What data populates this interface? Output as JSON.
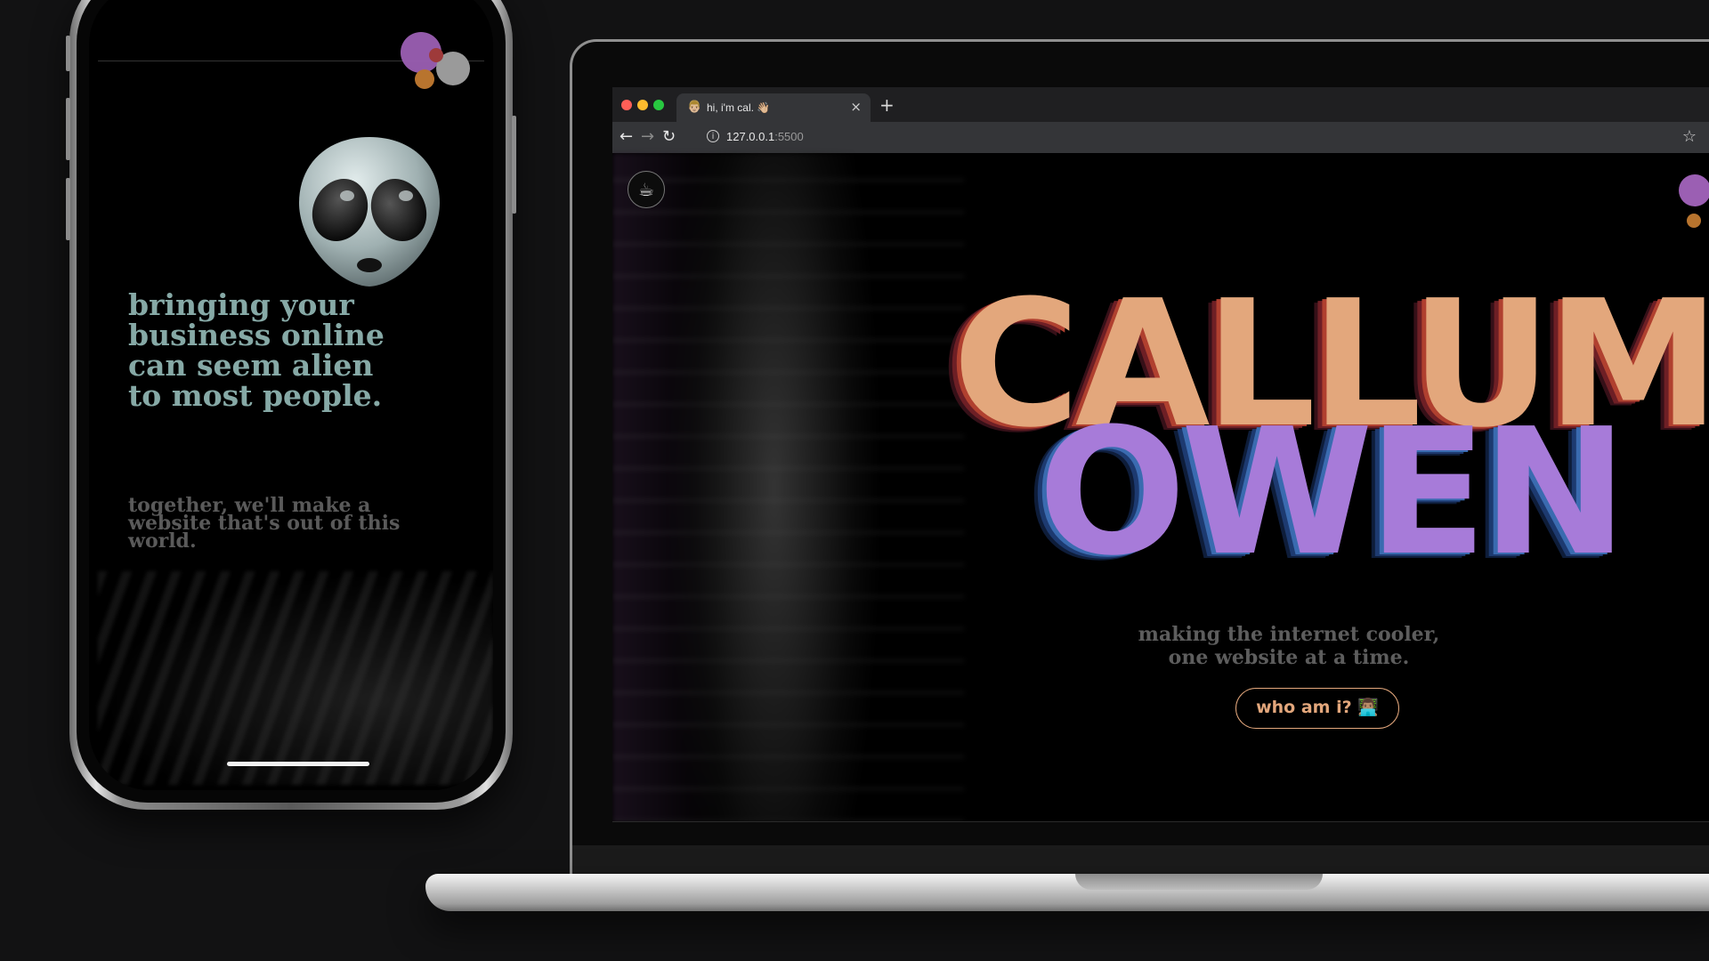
{
  "phone": {
    "headline": "bringing your business online can seem alien to most people.",
    "subtext": "together, we'll make a website that's out of this world.",
    "alien_icon": "alien-emoji"
  },
  "browser": {
    "tab": {
      "title": "hi, i'm cal. 👋🏼",
      "favicon": "👨🏼",
      "close": "×"
    },
    "new_tab": "+",
    "nav": {
      "back": "←",
      "forward": "→",
      "reload": "↻"
    },
    "address": {
      "host": "127.0.0.1",
      "port": ":5500",
      "info": "i"
    },
    "bookmark": "☆"
  },
  "site": {
    "coffee_icon": "☕",
    "title_line1": "CALLUM",
    "title_line2": "OWEN",
    "tagline_line1": "making the internet cooler,",
    "tagline_line2": "one website at a time.",
    "cta_label": "who am i? 👨🏽‍💻"
  },
  "colors": {
    "background": "#121213",
    "peach": "#e3a77c",
    "lavender": "#a77bd9",
    "sage": "#86a9a6",
    "dot_purple": "#9b5fb3",
    "dot_orange": "#b8742e",
    "dot_red": "#9e3a3a",
    "dot_grey": "#9a9a9a",
    "traffic_red": "#ff5f57",
    "traffic_yellow": "#febc2e",
    "traffic_green": "#28c840"
  }
}
